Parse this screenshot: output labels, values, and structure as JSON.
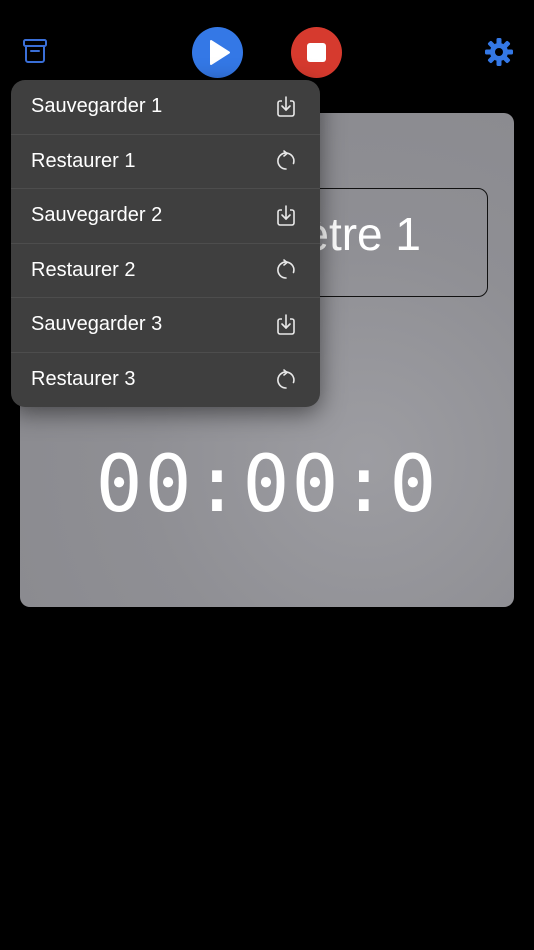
{
  "toolbar": {
    "archive_icon": "archive-box-icon",
    "play_icon": "play-icon",
    "stop_icon": "stop-icon",
    "settings_icon": "gear-icon",
    "accent_color": "#3478e6",
    "stop_color": "#d63a2e"
  },
  "card": {
    "name_visible": "ètre 1",
    "timer": "00:00:0"
  },
  "menu": {
    "items": [
      {
        "label": "Sauvegarder 1",
        "icon": "save-icon"
      },
      {
        "label": "Restaurer 1",
        "icon": "restore-icon"
      },
      {
        "label": "Sauvegarder 2",
        "icon": "save-icon"
      },
      {
        "label": "Restaurer 2",
        "icon": "restore-icon"
      },
      {
        "label": "Sauvegarder 3",
        "icon": "save-icon"
      },
      {
        "label": "Restaurer 3",
        "icon": "restore-icon"
      }
    ]
  }
}
